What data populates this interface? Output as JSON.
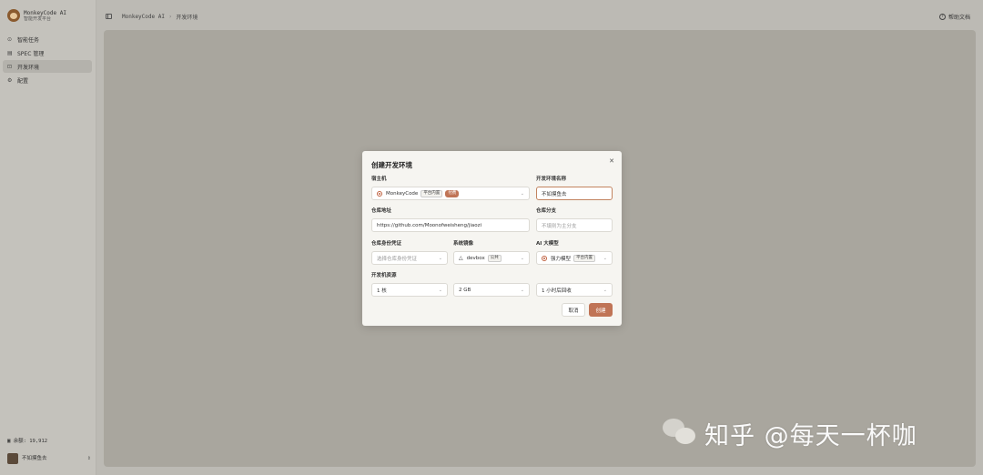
{
  "app": {
    "brand_name": "MonkeyCode AI",
    "brand_sub": "智能开发平台"
  },
  "sidebar": {
    "items": [
      {
        "label": "智能任务",
        "icon": "task-icon",
        "active": false
      },
      {
        "label": "SPEC 管理",
        "icon": "spec-icon",
        "active": false
      },
      {
        "label": "开发环境",
        "icon": "env-icon",
        "active": true
      },
      {
        "label": "配置",
        "icon": "gear-icon",
        "active": false
      }
    ],
    "balance": "余额: 19,912",
    "user": {
      "name": "不如摸鱼去",
      "sub": ""
    }
  },
  "header": {
    "breadcrumb": [
      "MonkeyCode AI",
      "开发环境"
    ],
    "help_label": "帮助文档"
  },
  "dialog": {
    "title": "创建开发环境",
    "host": {
      "label": "宿主机",
      "value": "MonkeyCode",
      "tag1": "平台内置",
      "tag2": "付费"
    },
    "env_name": {
      "label": "开发环境名称",
      "value": "不如摸鱼去"
    },
    "repo_url": {
      "label": "仓库地址",
      "value": "https://github.com/Moonofweisheng/jiaozi"
    },
    "branch": {
      "label": "仓库分支",
      "placeholder": "不填则为主分支"
    },
    "credential": {
      "label": "仓库身份凭证",
      "placeholder": "选择仓库身份凭证"
    },
    "image": {
      "label": "系统镜像",
      "value": "devbox",
      "tag": "公共"
    },
    "model": {
      "label": "AI 大模型",
      "value": "强力模型",
      "tag": "平台内置"
    },
    "resources": {
      "label": "开发机资源",
      "cpu": "1 核",
      "memory": "2 GB",
      "recycle": "1 小时后回收"
    },
    "cancel_label": "取消",
    "create_label": "创建"
  },
  "watermark": {
    "text": "知乎 @每天一杯咖"
  },
  "colors": {
    "accent": "#c07456",
    "overlay": "#a9a69e"
  }
}
